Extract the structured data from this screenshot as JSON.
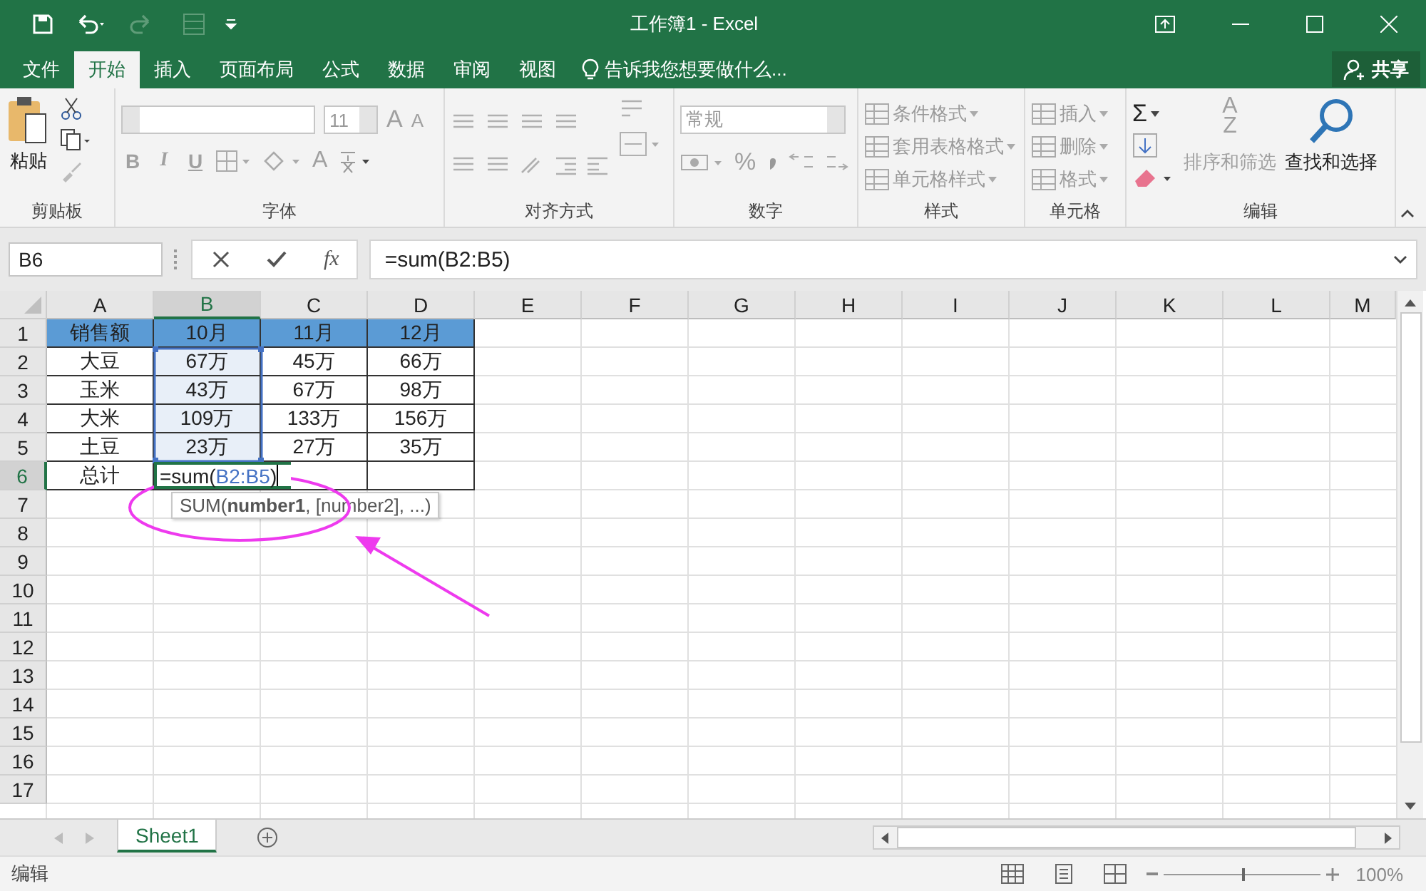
{
  "window": {
    "title": "工作簿1 - Excel"
  },
  "ribbon_tabs": [
    {
      "label": "文件",
      "selected": false
    },
    {
      "label": "开始",
      "selected": true
    },
    {
      "label": "插入",
      "selected": false
    },
    {
      "label": "页面布局",
      "selected": false
    },
    {
      "label": "公式",
      "selected": false
    },
    {
      "label": "数据",
      "selected": false
    },
    {
      "label": "审阅",
      "selected": false
    },
    {
      "label": "视图",
      "selected": false
    }
  ],
  "tell_me": "告诉我您想要做什么...",
  "share": "共享",
  "ribbon": {
    "groups": [
      {
        "kind": "clipboard",
        "label": "剪贴板",
        "paste": "粘贴"
      },
      {
        "kind": "font",
        "label": "字体",
        "font_size": "11",
        "format_buttons": [
          "B",
          "I",
          "U"
        ],
        "size_buttons": [
          "A",
          "A"
        ],
        "font_color": "A"
      },
      {
        "kind": "alignment",
        "label": "对齐方式"
      },
      {
        "kind": "number",
        "label": "数字",
        "format": "常规",
        "symbols": [
          "%"
        ]
      },
      {
        "kind": "styles",
        "label": "样式",
        "items": [
          "条件格式",
          "套用表格格式",
          "单元格样式"
        ]
      },
      {
        "kind": "cells",
        "label": "单元格",
        "items": [
          "插入",
          "删除",
          "格式"
        ]
      },
      {
        "kind": "editing",
        "label": "编辑",
        "sum": "Σ",
        "sort": "排序和筛选",
        "sort_letters": [
          "A",
          "Z"
        ],
        "find": "查找和选择"
      }
    ]
  },
  "formula_bar": {
    "name_box": "B6",
    "fx": "fx",
    "formula": "=sum(B2:B5)"
  },
  "sheet": {
    "columns": [
      {
        "label": "A",
        "selected": false
      },
      {
        "label": "B",
        "selected": true
      },
      {
        "label": "C",
        "selected": false
      },
      {
        "label": "D",
        "selected": false
      },
      {
        "label": "E",
        "selected": false
      },
      {
        "label": "F",
        "selected": false
      },
      {
        "label": "G",
        "selected": false
      },
      {
        "label": "H",
        "selected": false
      },
      {
        "label": "I",
        "selected": false
      },
      {
        "label": "J",
        "selected": false
      },
      {
        "label": "K",
        "selected": false
      },
      {
        "label": "L",
        "selected": false
      },
      {
        "label": "M",
        "selected": false
      }
    ],
    "rows": [
      {
        "label": "1",
        "selected": false,
        "kind": "header",
        "cells": [
          {
            "kind": "text",
            "text": "销售额",
            "highlighted": false
          },
          {
            "kind": "text",
            "text": "10月",
            "highlighted": false
          },
          {
            "kind": "text",
            "text": "11月",
            "highlighted": false
          },
          {
            "kind": "text",
            "text": "12月",
            "highlighted": false
          }
        ]
      },
      {
        "label": "2",
        "selected": false,
        "kind": "data",
        "cells": [
          {
            "kind": "text",
            "text": "大豆",
            "highlighted": false
          },
          {
            "kind": "text",
            "text": "67万",
            "highlighted": true
          },
          {
            "kind": "text",
            "text": "45万",
            "highlighted": false
          },
          {
            "kind": "text",
            "text": "66万",
            "highlighted": false
          }
        ]
      },
      {
        "label": "3",
        "selected": false,
        "kind": "data",
        "cells": [
          {
            "kind": "text",
            "text": "玉米",
            "highlighted": false
          },
          {
            "kind": "text",
            "text": "43万",
            "highlighted": true
          },
          {
            "kind": "text",
            "text": "67万",
            "highlighted": false
          },
          {
            "kind": "text",
            "text": "98万",
            "highlighted": false
          }
        ]
      },
      {
        "label": "4",
        "selected": false,
        "kind": "data",
        "cells": [
          {
            "kind": "text",
            "text": "大米",
            "highlighted": false
          },
          {
            "kind": "text",
            "text": "109万",
            "highlighted": true
          },
          {
            "kind": "text",
            "text": "133万",
            "highlighted": false
          },
          {
            "kind": "text",
            "text": "156万",
            "highlighted": false
          }
        ]
      },
      {
        "label": "5",
        "selected": false,
        "kind": "data",
        "cells": [
          {
            "kind": "text",
            "text": "土豆",
            "highlighted": false
          },
          {
            "kind": "text",
            "text": "23万",
            "highlighted": true
          },
          {
            "kind": "text",
            "text": "27万",
            "highlighted": false
          },
          {
            "kind": "text",
            "text": "35万",
            "highlighted": false
          }
        ]
      },
      {
        "label": "6",
        "selected": true,
        "kind": "data",
        "cells": [
          {
            "kind": "text",
            "text": "总计",
            "highlighted": false
          },
          {
            "kind": "editor",
            "parts": [
              {
                "kind": "plain",
                "text": "=sum("
              },
              {
                "kind": "ref",
                "text": "B2:B5"
              },
              {
                "kind": "plain",
                "text": ")"
              }
            ],
            "tooltip": "SUM(**number1**, [number2], ...)"
          },
          {
            "kind": "empty"
          },
          {
            "kind": "empty"
          }
        ]
      },
      {
        "label": "7",
        "selected": false
      },
      {
        "label": "8",
        "selected": false
      },
      {
        "label": "9",
        "selected": false
      },
      {
        "label": "10",
        "selected": false
      },
      {
        "label": "11",
        "selected": false
      },
      {
        "label": "12",
        "selected": false
      },
      {
        "label": "13",
        "selected": false
      },
      {
        "label": "14",
        "selected": false
      },
      {
        "label": "15",
        "selected": false
      },
      {
        "label": "16",
        "selected": false
      },
      {
        "label": "17",
        "selected": false
      }
    ]
  },
  "sheet_tabs": [
    {
      "label": "Sheet1",
      "selected": true
    }
  ],
  "status_bar": {
    "mode": "编辑",
    "zoom": "100%",
    "zoom_slider": {
      "level": 0.5
    }
  }
}
